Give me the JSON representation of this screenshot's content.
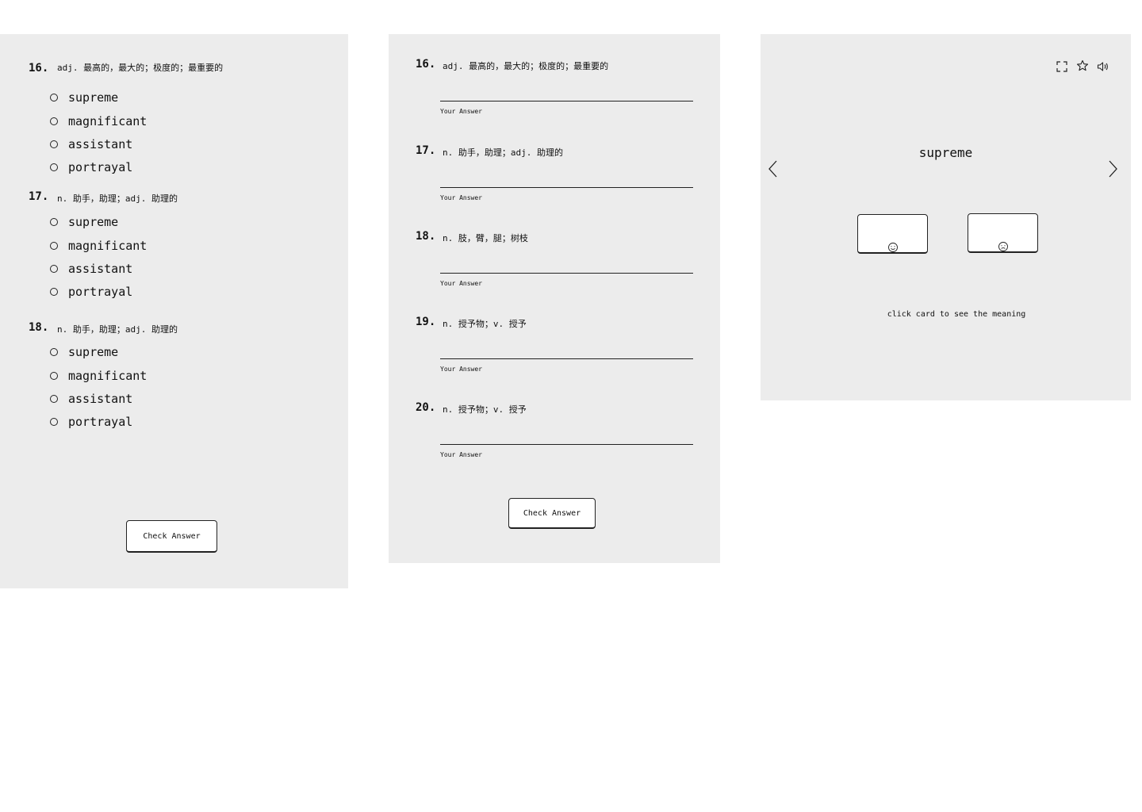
{
  "quiz": {
    "questions": [
      {
        "number": "16.",
        "definition": "adj. 最高的，最大的；极度的；最重要的",
        "options": [
          "supreme",
          "magnificant",
          "assistant",
          "portrayal"
        ]
      },
      {
        "number": "17.",
        "definition": "n. 助手，助理；adj. 助理的",
        "options": [
          "supreme",
          "magnificant",
          "assistant",
          "portrayal"
        ]
      },
      {
        "number": "18.",
        "definition": "n. 助手，助理；adj. 助理的",
        "options": [
          "supreme",
          "magnificant",
          "assistant",
          "portrayal"
        ]
      }
    ],
    "check_label": "Check Answer"
  },
  "fill": {
    "questions": [
      {
        "number": "16.",
        "definition": "adj. 最高的，最大的；极度的；最重要的",
        "caption": "Your Answer"
      },
      {
        "number": "17.",
        "definition": "n. 助手，助理；adj. 助理的",
        "caption": "Your Answer"
      },
      {
        "number": "18.",
        "definition": "n. 肢，臂，腿；树枝",
        "caption": "Your Answer"
      },
      {
        "number": "19.",
        "definition": "n. 授予物；v. 授予",
        "caption": "Your Answer"
      },
      {
        "number": "20.",
        "definition": "n. 授予物；v. 授予",
        "caption": "Your Answer"
      }
    ],
    "check_label": "Check Answer"
  },
  "flashcard": {
    "word": "supreme",
    "hint": "click card to see the meaning",
    "toolbar_icons": [
      "fullscreen-icon",
      "star-icon",
      "speaker-icon"
    ],
    "card_icons": [
      "smile-face-icon",
      "neutral-face-icon"
    ]
  }
}
